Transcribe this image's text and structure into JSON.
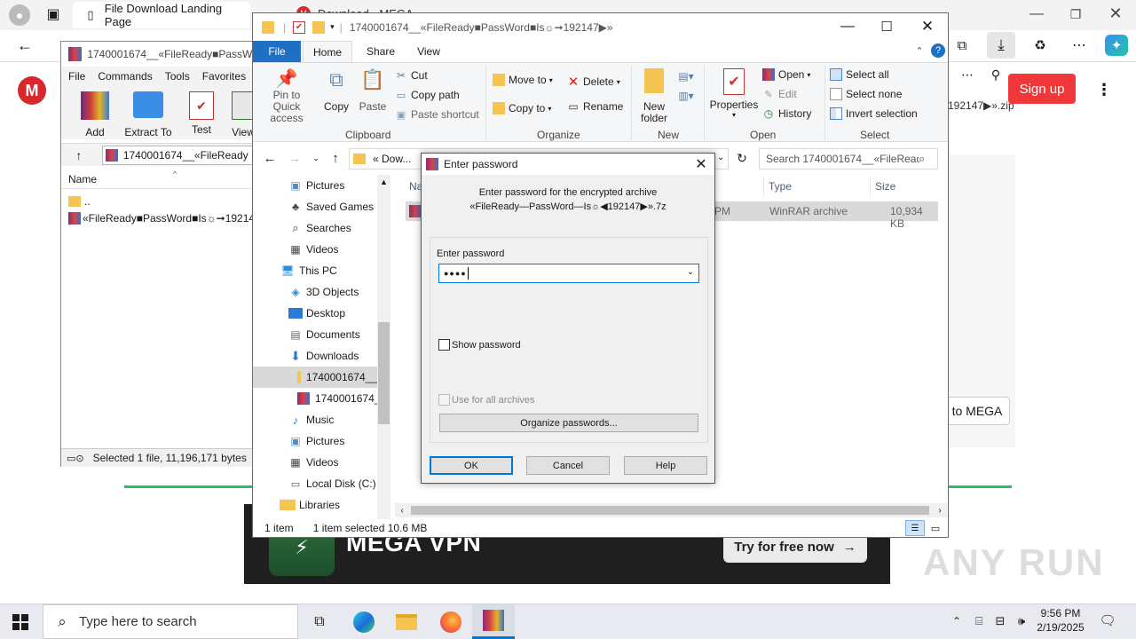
{
  "edge": {
    "tab1_title": "File Download Landing Page",
    "tab2_title": "Download - MEGA",
    "signup": "Sign up",
    "mega_logo": "M",
    "zip_suffix": "192147▶».zip",
    "to_mega": "to MEGA",
    "vpn_title": "MEGA VPN",
    "vpn_try": "Try for free now",
    "vpn_try_arrow": "→",
    "watermark": "ANY RUN"
  },
  "winrar": {
    "title": "1740001674__«FileReady■PassWord",
    "menu": [
      "File",
      "Commands",
      "Tools",
      "Favorites"
    ],
    "tools": [
      "Add",
      "Extract To",
      "Test",
      "View"
    ],
    "path": "1740001674__«FileReady",
    "col_name": "Name",
    "rows": [
      "..",
      "«FileReady■PassWord■Is☼➞19214"
    ],
    "status": "Selected 1 file, 11,196,171 bytes"
  },
  "explorer": {
    "title": "1740001674__«FileReady■PassWord■Is☼➞192147▶»",
    "tabs": {
      "file": "File",
      "home": "Home",
      "share": "Share",
      "view": "View"
    },
    "ribbon": {
      "pin": "Pin to Quick access",
      "copy": "Copy",
      "paste": "Paste",
      "cut": "Cut",
      "copy_path": "Copy path",
      "paste_shortcut": "Paste shortcut",
      "clipboard": "Clipboard",
      "move_to": "Move to",
      "copy_to": "Copy to",
      "delete": "Delete",
      "rename": "Rename",
      "organize": "Organize",
      "new_folder": "New folder",
      "new": "New",
      "properties": "Properties",
      "open": "Open",
      "edit": "Edit",
      "history": "History",
      "open_group": "Open",
      "select_all": "Select all",
      "select_none": "Select none",
      "invert_selection": "Invert selection",
      "select_group": "Select"
    },
    "path_text": "«  Dow...",
    "search_placeholder": "Search 1740001674__«FileRead...",
    "tree": [
      "Pictures",
      "Saved Games",
      "Searches",
      "Videos",
      "This PC",
      "3D Objects",
      "Desktop",
      "Documents",
      "Downloads",
      "1740001674__",
      "1740001674__",
      "Music",
      "Pictures",
      "Videos",
      "Local Disk (C:)",
      "Libraries"
    ],
    "columns": {
      "name": "Na",
      "type": "Type",
      "size": "Size"
    },
    "file_row": {
      "date_frag": "PM",
      "type": "WinRAR archive",
      "size": "10,934 KB"
    },
    "status": {
      "items": "1 item",
      "selected": "1 item selected  10.6 MB"
    }
  },
  "dialog": {
    "title": "Enter password",
    "prompt_line1": "Enter password for the encrypted archive",
    "prompt_line2": "«FileReady—PassWord—Is☼◀192147▶».7z",
    "field_label": "Enter password",
    "password_mask": "●●●●",
    "show_password": "Show password",
    "use_for_all": "Use for all archives",
    "organize": "Organize passwords...",
    "ok": "OK",
    "cancel": "Cancel",
    "help": "Help"
  },
  "taskbar": {
    "search_placeholder": "Type here to search",
    "time": "9:56 PM",
    "date": "2/19/2025"
  }
}
